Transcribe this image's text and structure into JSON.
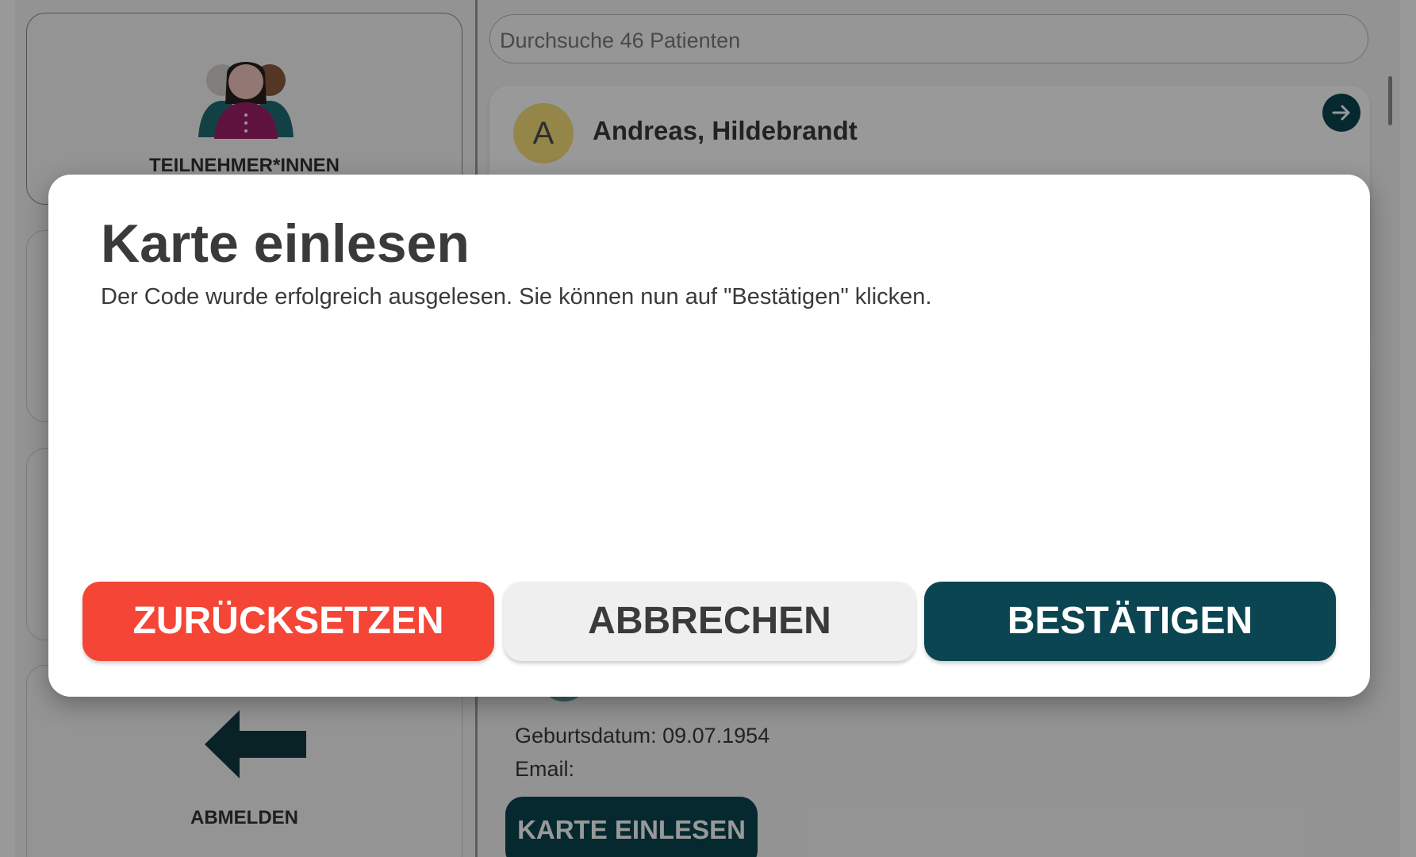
{
  "sidebar": {
    "participants_label": "TEILNEHMER*INNEN",
    "logout_label": "ABMELDEN"
  },
  "search": {
    "placeholder": "Durchsuche 46 Patienten"
  },
  "patients": [
    {
      "avatar_letter": "A",
      "name": "Andreas, Hildebrandt"
    }
  ],
  "patient_detail": {
    "birth_label": "Geburtsdatum: 09.07.1954",
    "email_label": "Email:",
    "read_card_button": "KARTE EINLESEN"
  },
  "modal": {
    "title": "Karte einlesen",
    "message": "Der Code wurde erfolgreich ausgelesen. Sie können nun auf \"Bestätigen\" klicken.",
    "buttons": {
      "reset": "ZURÜCKSETZEN",
      "cancel": "ABBRECHEN",
      "confirm": "BESTÄTIGEN"
    }
  },
  "colors": {
    "primary": "#0b4551",
    "danger": "#f44536",
    "avatar": "#f7de7b",
    "neutral_button": "#efefef"
  },
  "icons": [
    "participants-icon",
    "arrow-left-icon",
    "arrow-right-icon"
  ]
}
